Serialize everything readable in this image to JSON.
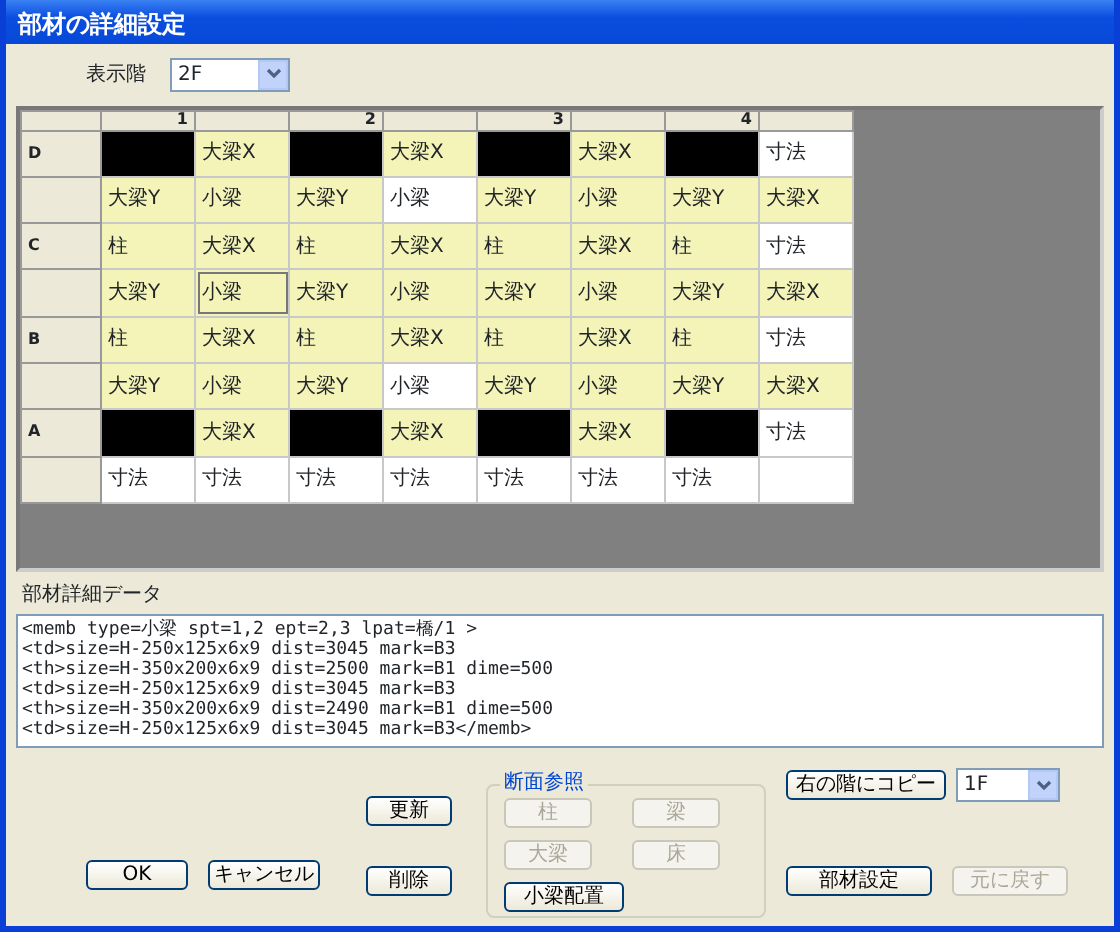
{
  "window": {
    "title": "部材の詳細設定"
  },
  "floor_selector": {
    "label": "表示階",
    "value": "2F"
  },
  "grid": {
    "columns": [
      "1",
      "",
      "2",
      "",
      "3",
      "",
      "4",
      ""
    ],
    "rows": [
      {
        "label": "D",
        "cells": [
          {
            "kind": "node"
          },
          {
            "kind": "member",
            "text": "大梁X"
          },
          {
            "kind": "node"
          },
          {
            "kind": "member",
            "text": "大梁X"
          },
          {
            "kind": "node"
          },
          {
            "kind": "member",
            "text": "大梁X"
          },
          {
            "kind": "node"
          },
          {
            "kind": "plain",
            "text": "寸法"
          }
        ]
      },
      {
        "label": "",
        "cells": [
          {
            "kind": "member",
            "text": "大梁Y"
          },
          {
            "kind": "member",
            "text": "小梁"
          },
          {
            "kind": "member",
            "text": "大梁Y"
          },
          {
            "kind": "plain",
            "text": "小梁"
          },
          {
            "kind": "member",
            "text": "大梁Y"
          },
          {
            "kind": "member",
            "text": "小梁"
          },
          {
            "kind": "member",
            "text": "大梁Y"
          },
          {
            "kind": "member",
            "text": "大梁X"
          }
        ]
      },
      {
        "label": "C",
        "cells": [
          {
            "kind": "member",
            "text": "柱"
          },
          {
            "kind": "member",
            "text": "大梁X"
          },
          {
            "kind": "member",
            "text": "柱"
          },
          {
            "kind": "member",
            "text": "大梁X"
          },
          {
            "kind": "member",
            "text": "柱"
          },
          {
            "kind": "member",
            "text": "大梁X"
          },
          {
            "kind": "member",
            "text": "柱"
          },
          {
            "kind": "plain",
            "text": "寸法"
          }
        ]
      },
      {
        "label": "",
        "cells": [
          {
            "kind": "member",
            "text": "大梁Y"
          },
          {
            "kind": "member",
            "text": "小梁",
            "selected": true
          },
          {
            "kind": "member",
            "text": "大梁Y"
          },
          {
            "kind": "member",
            "text": "小梁"
          },
          {
            "kind": "member",
            "text": "大梁Y"
          },
          {
            "kind": "member",
            "text": "小梁"
          },
          {
            "kind": "member",
            "text": "大梁Y"
          },
          {
            "kind": "member",
            "text": "大梁X"
          }
        ]
      },
      {
        "label": "B",
        "cells": [
          {
            "kind": "member",
            "text": "柱"
          },
          {
            "kind": "member",
            "text": "大梁X"
          },
          {
            "kind": "member",
            "text": "柱"
          },
          {
            "kind": "member",
            "text": "大梁X"
          },
          {
            "kind": "member",
            "text": "柱"
          },
          {
            "kind": "member",
            "text": "大梁X"
          },
          {
            "kind": "member",
            "text": "柱"
          },
          {
            "kind": "plain",
            "text": "寸法"
          }
        ]
      },
      {
        "label": "",
        "cells": [
          {
            "kind": "member",
            "text": "大梁Y"
          },
          {
            "kind": "member",
            "text": "小梁"
          },
          {
            "kind": "member",
            "text": "大梁Y"
          },
          {
            "kind": "plain",
            "text": "小梁"
          },
          {
            "kind": "member",
            "text": "大梁Y"
          },
          {
            "kind": "member",
            "text": "小梁"
          },
          {
            "kind": "member",
            "text": "大梁Y"
          },
          {
            "kind": "member",
            "text": "大梁X"
          }
        ]
      },
      {
        "label": "A",
        "cells": [
          {
            "kind": "node"
          },
          {
            "kind": "member",
            "text": "大梁X"
          },
          {
            "kind": "node"
          },
          {
            "kind": "member",
            "text": "大梁X"
          },
          {
            "kind": "node"
          },
          {
            "kind": "member",
            "text": "大梁X"
          },
          {
            "kind": "node"
          },
          {
            "kind": "plain",
            "text": "寸法"
          }
        ]
      },
      {
        "label": "",
        "cells": [
          {
            "kind": "plain",
            "text": "寸法"
          },
          {
            "kind": "plain",
            "text": "寸法"
          },
          {
            "kind": "plain",
            "text": "寸法"
          },
          {
            "kind": "plain",
            "text": "寸法"
          },
          {
            "kind": "plain",
            "text": "寸法"
          },
          {
            "kind": "plain",
            "text": "寸法"
          },
          {
            "kind": "plain",
            "text": "寸法"
          },
          {
            "kind": "plain"
          }
        ]
      }
    ]
  },
  "detail": {
    "label": "部材詳細データ",
    "lines": [
      "<memb type=小梁 spt=1,2 ept=2,3 lpat=橋/1 >",
      "<td>size=H-250x125x6x9 dist=3045 mark=B3",
      "<th>size=H-350x200x6x9 dist=2500 mark=B1 dime=500",
      "<td>size=H-250x125x6x9 dist=3045 mark=B3",
      "<th>size=H-350x200x6x9 dist=2490 mark=B1 dime=500",
      "<td>size=H-250x125x6x9 dist=3045 mark=B3</memb>"
    ]
  },
  "buttons": {
    "ok": {
      "label": "OK",
      "disabled": false
    },
    "cancel": {
      "label": "キャンセル",
      "disabled": false
    },
    "update": {
      "label": "更新",
      "disabled": false
    },
    "delete": {
      "label": "削除",
      "disabled": false
    }
  },
  "section_reference": {
    "title": "断面参照",
    "buttons": [
      {
        "label": "柱",
        "disabled": true
      },
      {
        "label": "梁",
        "disabled": true
      },
      {
        "label": "大梁",
        "disabled": true
      },
      {
        "label": "床",
        "disabled": true
      },
      {
        "label": "小梁配置",
        "disabled": false
      }
    ]
  },
  "copy": {
    "button": {
      "label": "右の階にコピー",
      "disabled": false
    },
    "floor": "1F"
  },
  "member_settings": {
    "label": "部材設定",
    "disabled": false
  },
  "revert": {
    "label": "元に戻す",
    "disabled": true
  }
}
